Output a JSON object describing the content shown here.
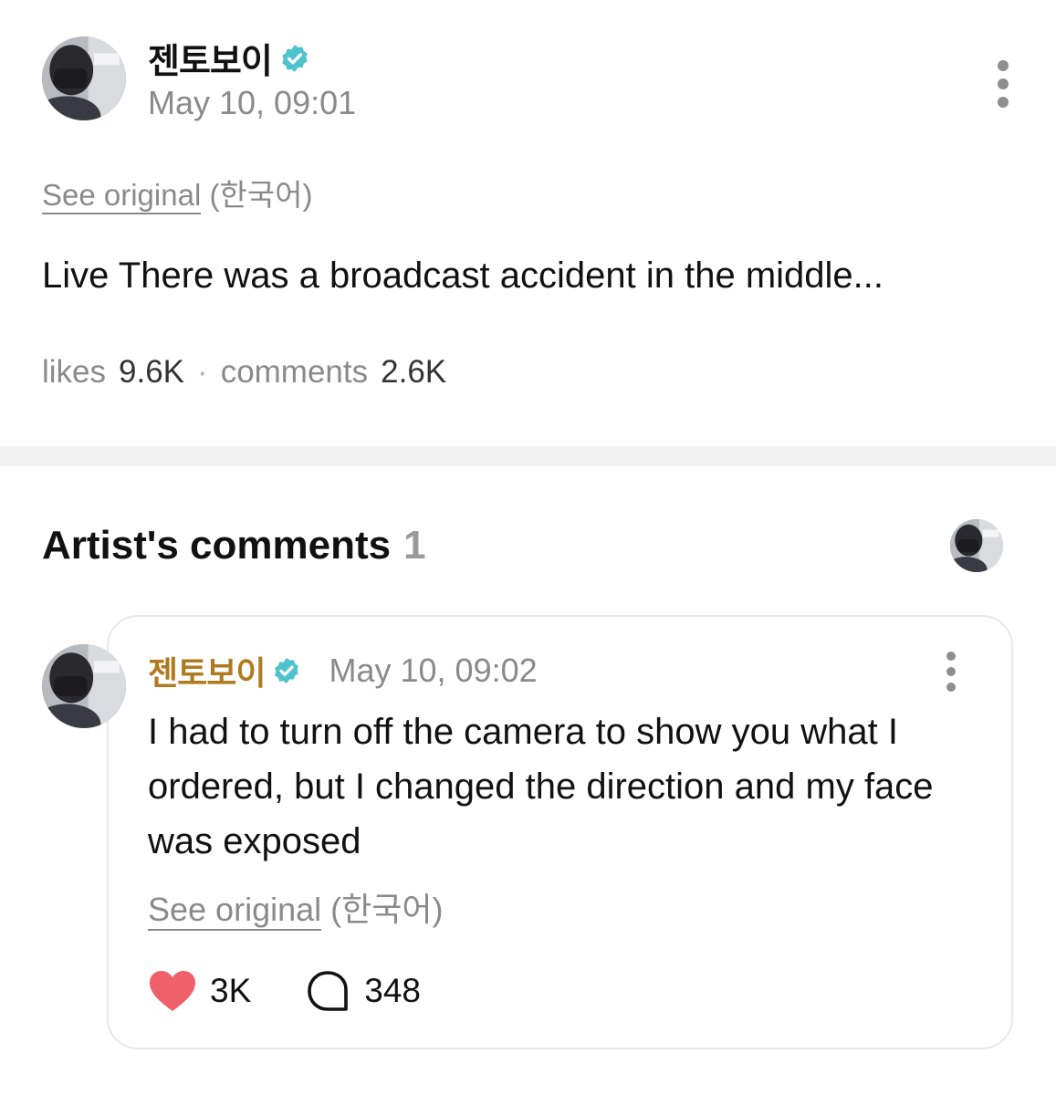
{
  "post": {
    "author": "젠토보이",
    "time": "May 10, 09:01",
    "see_original": "See original",
    "language": "(한국어)",
    "body": "Live There was a broadcast accident in the middle...",
    "likes_label": "likes",
    "likes_count": "9.6K",
    "separator": "·",
    "comments_label": "comments",
    "comments_count": "2.6K"
  },
  "artist_comments": {
    "title": "Artist's comments",
    "count": "1"
  },
  "comment": {
    "author": "젠토보이",
    "time": "May 10, 09:02",
    "text": "I had to turn off the camera to show you what I ordered, but I changed the direction and my face was exposed",
    "see_original": "See original",
    "language": "(한국어)",
    "like_count": "3K",
    "reply_count": "348"
  },
  "icons": {
    "verified": "verified-badge-icon",
    "more": "more-vertical-icon",
    "like": "heart-icon",
    "reply": "speech-bubble-icon"
  },
  "colors": {
    "verified": "#4dc3ce",
    "comment_author": "#b07a1e",
    "heart": "#f0606a",
    "muted_text": "#8a8a8a"
  }
}
